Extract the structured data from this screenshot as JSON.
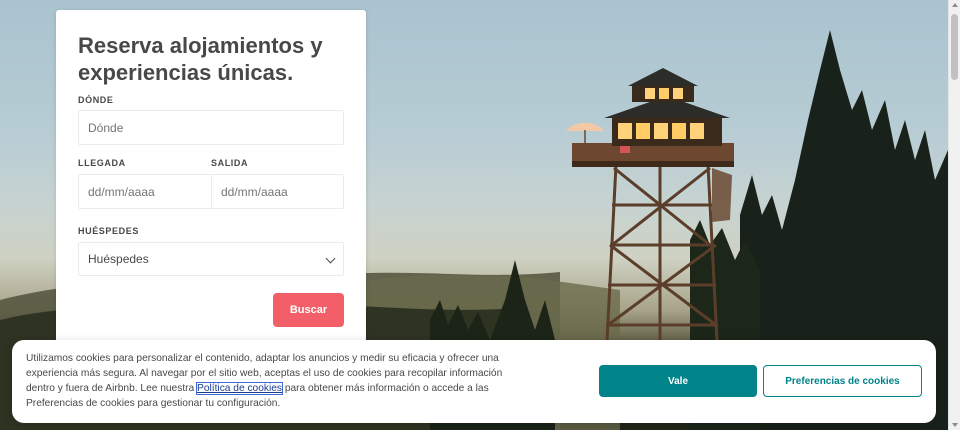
{
  "hero": {
    "title": "Reserva alojamientos y experiencias únicas.",
    "where": {
      "label": "DÓNDE",
      "placeholder": "Dónde"
    },
    "checkin": {
      "label": "LLEGADA",
      "placeholder": "dd/mm/aaaa"
    },
    "checkout": {
      "label": "SALIDA",
      "placeholder": "dd/mm/aaaa"
    },
    "guests": {
      "label": "HUÉSPEDES",
      "value": "Huéspedes"
    },
    "search_label": "Buscar"
  },
  "cookie_banner": {
    "text_before": "Utilizamos cookies para personalizar el contenido, adaptar los anuncios y medir su eficacia y ofrecer una experiencia más segura. Al navegar por el sitio web, aceptas el uso de cookies para recopilar información dentro y fuera de Airbnb. Lee nuestra ",
    "link_label": "Política de cookies",
    "text_after": " para obtener más información o accede a las Preferencias de cookies para gestionar tu configuración.",
    "accept_label": "Vale",
    "preferences_label": "Preferencias de cookies"
  },
  "colors": {
    "brand": "#f25f68",
    "accent": "#00848a",
    "text": "#484848"
  },
  "icons": {
    "guests_dropdown": "chevron-down-icon"
  }
}
